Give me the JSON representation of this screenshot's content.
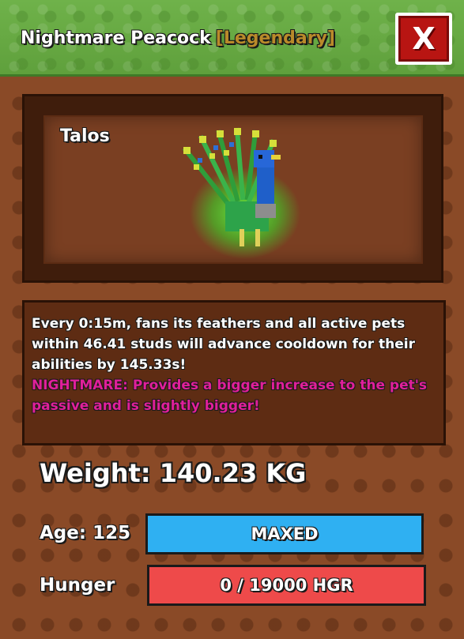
{
  "header": {
    "pet_species": "Nightmare Peacock",
    "rarity": "[Legendary]",
    "close_label": "X"
  },
  "pet": {
    "name": "Talos",
    "image_icon": "peacock-pet-icon"
  },
  "description": {
    "ability": "Every 0:15m, fans its feathers and all active pets within 46.41 studs will advance cooldown for their abilities by 145.33s!",
    "mutation": "NIGHTMARE: Provides a bigger increase to the pet's passive and is slightly bigger!"
  },
  "stats": {
    "weight_text": "Weight: 140.23 KG",
    "age_label": "Age: 125",
    "age_bar_text": "MAXED",
    "hunger_label": "Hunger",
    "hunger_bar_text": "0 / 19000 HGR"
  },
  "colors": {
    "header_green": "#6fb24a",
    "rarity_gold": "#b98a2a",
    "close_red": "#b81512",
    "nightmare_pink": "#e0209a",
    "age_bar_blue": "#2fb0f2",
    "hunger_bar_red": "#ee4a4a"
  }
}
